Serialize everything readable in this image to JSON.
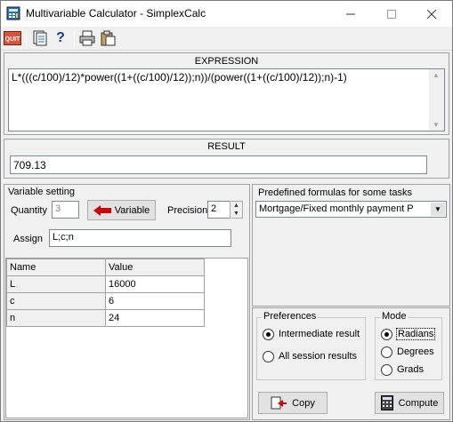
{
  "window": {
    "title": "Multivariable Calculator - SimplexCalc"
  },
  "toolbar": {
    "quit_label": "QUIT",
    "help_label": "?"
  },
  "expression": {
    "title": "EXPRESSION",
    "value": "L*(((c/100)/12)*power((1+((c/100)/12));n))/(power((1+((c/100)/12));n)-1)"
  },
  "result": {
    "title": "RESULT",
    "value": "709.13"
  },
  "variable_setting": {
    "title": "Variable setting",
    "quantity_label": "Quantity",
    "quantity_value": "3",
    "variable_button": "Variable",
    "precision_label": "Precision",
    "precision_value": "2",
    "assign_label": "Assign",
    "assign_value": "L;c;n"
  },
  "variables_table": {
    "columns": [
      "Name",
      "Value"
    ],
    "rows": [
      {
        "name": "L",
        "value": "16000"
      },
      {
        "name": "c",
        "value": "6"
      },
      {
        "name": "n",
        "value": "24"
      }
    ]
  },
  "predefined": {
    "title": "Predefined formulas for some tasks",
    "selected": "Mortgage/Fixed monthly payment P"
  },
  "preferences": {
    "title": "Preferences",
    "options": [
      "Intermediate result",
      "All session results"
    ],
    "selected_index": 0
  },
  "mode": {
    "title": "Mode",
    "options": [
      "Radians",
      "Degrees",
      "Grads"
    ],
    "selected_index": 0
  },
  "buttons": {
    "copy": "Copy",
    "compute": "Compute"
  },
  "colors": {
    "quit_bg": "#c0392b",
    "arrow_red": "#cc0000"
  }
}
